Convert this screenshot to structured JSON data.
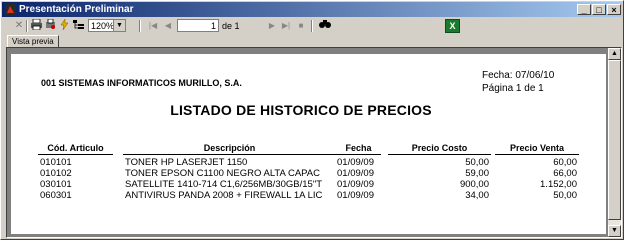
{
  "window": {
    "title": "Presentación Preliminar"
  },
  "toolbar": {
    "zoom": "120%",
    "page_current": "1",
    "page_of": "de 1"
  },
  "tabs": [
    "Vista previa"
  ],
  "report": {
    "company": "001 SISTEMAS INFORMATICOS MURILLO, S.A.",
    "date": "Fecha: 07/06/10",
    "page": "Página 1 de 1",
    "title": "LISTADO DE HISTORICO DE PRECIOS",
    "headers": [
      "Cód. Articulo",
      "Descripción",
      "Fecha",
      "Precio Costo",
      "Precio Venta"
    ],
    "rows": [
      [
        "010101",
        "TONER HP LASERJET 1150",
        "01/09/09",
        "50,00",
        "60,00"
      ],
      [
        "010102",
        "TONER EPSON C1100 NEGRO ALTA CAPAC",
        "01/09/09",
        "59,00",
        "66,00"
      ],
      [
        "030101",
        "SATELLITE 1410-714 C1,6/256MB/30GB/15\"T",
        "01/09/09",
        "900,00",
        "1.152,00"
      ],
      [
        "060301",
        "ANTIVIRUS PANDA 2008 + FIREWALL 1A LIC",
        "01/09/09",
        "34,00",
        "50,00"
      ]
    ]
  }
}
